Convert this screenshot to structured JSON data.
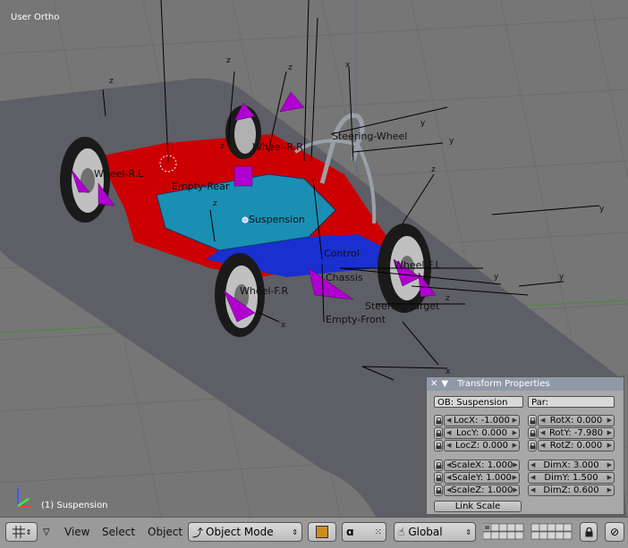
{
  "viewport": {
    "view_name": "User Ortho",
    "status": "(1) Suspension"
  },
  "scene_labels": {
    "steering_wheel": "Steering-Wheel",
    "wheel_r_l": "Wheel-R.L",
    "wheel_f_r": "Wheel-F.R",
    "wheel_f_l": "Wheel-F.L",
    "wheel_r_r": "Wheel-R.R",
    "suspension": "Suspension",
    "empty_rear": "Empty-Rear",
    "empty_front": "Empty-Front",
    "steering_target": "Steering-Target",
    "chassis": "Chassis",
    "control": "Control"
  },
  "axis_letters": {
    "z": "z",
    "y": "y",
    "x": "x"
  },
  "transform_panel": {
    "title": "Transform Properties",
    "ob_field": "OB: Suspension",
    "par_field": "Par:",
    "loc": [
      "LocX: -1.000",
      "LocY: 0.000",
      "LocZ: 0.000"
    ],
    "rot": [
      "RotX: 0.000",
      "RotY: -7.980",
      "RotZ: 0.000"
    ],
    "scale": [
      "ScaleX: 1.000",
      "ScaleY: 1.000",
      "ScaleZ: 1.000"
    ],
    "dim": [
      "DimX: 3.000",
      "DimY: 1.500",
      "DimZ: 0.600"
    ],
    "link_scale": "Link Scale"
  },
  "header": {
    "menus": [
      "View",
      "Select",
      "Object"
    ],
    "mode": "Object Mode",
    "orientation": "Global"
  },
  "colors": {
    "viewport_bg": "#767676",
    "ground_plane": "#5e5e66",
    "chassis_red": "#cc0000",
    "panel_blue": "#1a8fb3",
    "empty_magenta": "#b000d0",
    "panel_bg": "#a8a8a8",
    "header_bg": "#9a9a9a"
  },
  "icons": {
    "editor_type": "grid-icon",
    "mode": "object-mode-icon",
    "lock": "lock-icon"
  }
}
